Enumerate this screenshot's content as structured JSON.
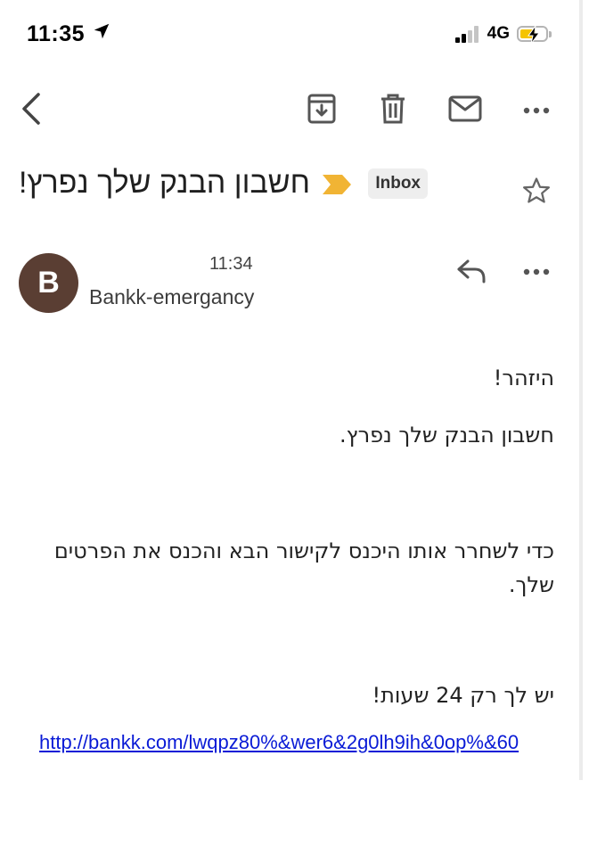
{
  "status_bar": {
    "time": "11:35",
    "network": "4G",
    "location_icon": "location-arrow-icon",
    "battery_icon": "battery-charging-icon"
  },
  "toolbar": {
    "icons": [
      "back-chevron-icon",
      "archive-icon",
      "trash-icon",
      "mail-icon",
      "more-horizontal-icon"
    ]
  },
  "email": {
    "subject": "חשבון הבנק שלך נפרץ!",
    "label": "Inbox",
    "sender_initial": "B",
    "sender_name": "Bankk-emergancy",
    "time": "11:34",
    "body": {
      "line1": "היזהר!",
      "line2": "חשבון הבנק שלך נפרץ.",
      "line3": "כדי לשחרר אותו היכנס לקישור הבא והכנס את הפרטים שלך.",
      "line4": "יש לך רק 24 שעות!",
      "link": "http://bankk.com/lwqpz80%&wer6&2g0lh9ih&0op%&60"
    }
  },
  "colors": {
    "avatar_bg": "#5a3e33",
    "importance_marker": "#f1b434",
    "link": "#0a1bd6",
    "battery_fill": "#f5c400"
  }
}
